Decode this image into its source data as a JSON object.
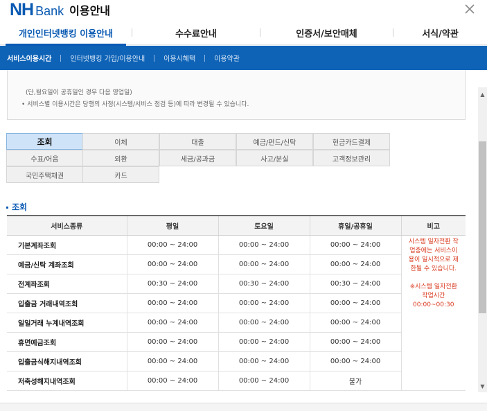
{
  "header": {
    "logo_nh": "NH",
    "logo_bank": "Bank",
    "title": "이용안내"
  },
  "main_tabs": [
    {
      "label": "개인인터넷뱅킹 이용안내",
      "active": true
    },
    {
      "label": "수수료안내",
      "active": false
    },
    {
      "label": "인증서/보안매체",
      "active": false
    },
    {
      "label": "서식/약관",
      "active": false
    }
  ],
  "subnav": [
    {
      "label": "서비스이용시간",
      "active": true
    },
    {
      "label": "인터넷뱅킹 가입/이용안내",
      "active": false
    },
    {
      "label": "이용시혜택",
      "active": false
    },
    {
      "label": "이용약관",
      "active": false
    }
  ],
  "notice": {
    "line1": "(단,월요일이 공휴일인 경우 다음 영업일)",
    "line2": "• 서비스별 이용시간은 당행의 사정(시스템/서비스 점검 등)에 따라 변경될 수 있습니다."
  },
  "categories": [
    {
      "label": "조회",
      "active": true
    },
    {
      "label": "이체",
      "active": false
    },
    {
      "label": "대출",
      "active": false
    },
    {
      "label": "예금/펀드/신탁",
      "active": false
    },
    {
      "label": "현금카드결제",
      "active": false
    },
    {
      "label": "수표/어음",
      "active": false
    },
    {
      "label": "외환",
      "active": false
    },
    {
      "label": "세금/공과금",
      "active": false
    },
    {
      "label": "사고/분실",
      "active": false
    },
    {
      "label": "고객정보관리",
      "active": false
    },
    {
      "label": "국민주택채권",
      "active": false
    },
    {
      "label": "카드",
      "active": false
    }
  ],
  "section_title": "조회",
  "table": {
    "headers": [
      "서비스종류",
      "평일",
      "토요일",
      "휴일/공휴일",
      "비고"
    ],
    "rows": [
      {
        "service": "기본계좌조회",
        "weekday": "00:00 ~ 24:00",
        "saturday": "00:00 ~ 24:00",
        "holiday": "00:00 ~ 24:00"
      },
      {
        "service": "예금/신탁 계좌조회",
        "weekday": "00:00 ~ 24:00",
        "saturday": "00:00 ~ 24:00",
        "holiday": "00:00 ~ 24:00"
      },
      {
        "service": "전계좌조회",
        "weekday": "00:30 ~ 24:00",
        "saturday": "00:30 ~ 24:00",
        "holiday": "00:30 ~ 24:00"
      },
      {
        "service": "입출금 거래내역조회",
        "weekday": "00:00 ~ 24:00",
        "saturday": "00:00 ~ 24:00",
        "holiday": "00:00 ~ 24:00"
      },
      {
        "service": "일일거래 누계내역조회",
        "weekday": "00:00 ~ 24:00",
        "saturday": "00:00 ~ 24:00",
        "holiday": "00:00 ~ 24:00"
      },
      {
        "service": "휴면예금조회",
        "weekday": "00:00 ~ 24:00",
        "saturday": "00:00 ~ 24:00",
        "holiday": "00:00 ~ 24:00"
      },
      {
        "service": "입출금식해지내역조회",
        "weekday": "00:00 ~ 24:00",
        "saturday": "00:00 ~ 24:00",
        "holiday": "00:00 ~ 24:00"
      },
      {
        "service": "저축성해지내역조회",
        "weekday": "00:00 ~ 24:00",
        "saturday": "00:00 ~ 24:00",
        "holiday": "불가"
      }
    ],
    "remark_line1": "시스템 일자전환 작업중에는 서비스이용이 일시적으로 제한될 수 있습니다.",
    "remark_line2": "※시스템 일자전환 작업시간 00:00~00:30"
  },
  "colors": {
    "brand_blue": "#0a5ab3",
    "subnav_blue": "#0e63b7",
    "remark_red": "#d9371b"
  }
}
